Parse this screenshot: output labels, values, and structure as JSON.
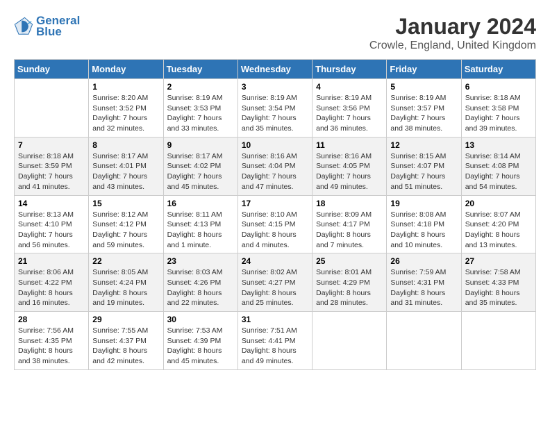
{
  "header": {
    "logo_line1": "General",
    "logo_line2": "Blue",
    "title": "January 2024",
    "subtitle": "Crowle, England, United Kingdom"
  },
  "weekdays": [
    "Sunday",
    "Monday",
    "Tuesday",
    "Wednesday",
    "Thursday",
    "Friday",
    "Saturday"
  ],
  "weeks": [
    [
      {
        "day": "",
        "info": ""
      },
      {
        "day": "1",
        "info": "Sunrise: 8:20 AM\nSunset: 3:52 PM\nDaylight: 7 hours\nand 32 minutes."
      },
      {
        "day": "2",
        "info": "Sunrise: 8:19 AM\nSunset: 3:53 PM\nDaylight: 7 hours\nand 33 minutes."
      },
      {
        "day": "3",
        "info": "Sunrise: 8:19 AM\nSunset: 3:54 PM\nDaylight: 7 hours\nand 35 minutes."
      },
      {
        "day": "4",
        "info": "Sunrise: 8:19 AM\nSunset: 3:56 PM\nDaylight: 7 hours\nand 36 minutes."
      },
      {
        "day": "5",
        "info": "Sunrise: 8:19 AM\nSunset: 3:57 PM\nDaylight: 7 hours\nand 38 minutes."
      },
      {
        "day": "6",
        "info": "Sunrise: 8:18 AM\nSunset: 3:58 PM\nDaylight: 7 hours\nand 39 minutes."
      }
    ],
    [
      {
        "day": "7",
        "info": "Sunrise: 8:18 AM\nSunset: 3:59 PM\nDaylight: 7 hours\nand 41 minutes."
      },
      {
        "day": "8",
        "info": "Sunrise: 8:17 AM\nSunset: 4:01 PM\nDaylight: 7 hours\nand 43 minutes."
      },
      {
        "day": "9",
        "info": "Sunrise: 8:17 AM\nSunset: 4:02 PM\nDaylight: 7 hours\nand 45 minutes."
      },
      {
        "day": "10",
        "info": "Sunrise: 8:16 AM\nSunset: 4:04 PM\nDaylight: 7 hours\nand 47 minutes."
      },
      {
        "day": "11",
        "info": "Sunrise: 8:16 AM\nSunset: 4:05 PM\nDaylight: 7 hours\nand 49 minutes."
      },
      {
        "day": "12",
        "info": "Sunrise: 8:15 AM\nSunset: 4:07 PM\nDaylight: 7 hours\nand 51 minutes."
      },
      {
        "day": "13",
        "info": "Sunrise: 8:14 AM\nSunset: 4:08 PM\nDaylight: 7 hours\nand 54 minutes."
      }
    ],
    [
      {
        "day": "14",
        "info": "Sunrise: 8:13 AM\nSunset: 4:10 PM\nDaylight: 7 hours\nand 56 minutes."
      },
      {
        "day": "15",
        "info": "Sunrise: 8:12 AM\nSunset: 4:12 PM\nDaylight: 7 hours\nand 59 minutes."
      },
      {
        "day": "16",
        "info": "Sunrise: 8:11 AM\nSunset: 4:13 PM\nDaylight: 8 hours\nand 1 minute."
      },
      {
        "day": "17",
        "info": "Sunrise: 8:10 AM\nSunset: 4:15 PM\nDaylight: 8 hours\nand 4 minutes."
      },
      {
        "day": "18",
        "info": "Sunrise: 8:09 AM\nSunset: 4:17 PM\nDaylight: 8 hours\nand 7 minutes."
      },
      {
        "day": "19",
        "info": "Sunrise: 8:08 AM\nSunset: 4:18 PM\nDaylight: 8 hours\nand 10 minutes."
      },
      {
        "day": "20",
        "info": "Sunrise: 8:07 AM\nSunset: 4:20 PM\nDaylight: 8 hours\nand 13 minutes."
      }
    ],
    [
      {
        "day": "21",
        "info": "Sunrise: 8:06 AM\nSunset: 4:22 PM\nDaylight: 8 hours\nand 16 minutes."
      },
      {
        "day": "22",
        "info": "Sunrise: 8:05 AM\nSunset: 4:24 PM\nDaylight: 8 hours\nand 19 minutes."
      },
      {
        "day": "23",
        "info": "Sunrise: 8:03 AM\nSunset: 4:26 PM\nDaylight: 8 hours\nand 22 minutes."
      },
      {
        "day": "24",
        "info": "Sunrise: 8:02 AM\nSunset: 4:27 PM\nDaylight: 8 hours\nand 25 minutes."
      },
      {
        "day": "25",
        "info": "Sunrise: 8:01 AM\nSunset: 4:29 PM\nDaylight: 8 hours\nand 28 minutes."
      },
      {
        "day": "26",
        "info": "Sunrise: 7:59 AM\nSunset: 4:31 PM\nDaylight: 8 hours\nand 31 minutes."
      },
      {
        "day": "27",
        "info": "Sunrise: 7:58 AM\nSunset: 4:33 PM\nDaylight: 8 hours\nand 35 minutes."
      }
    ],
    [
      {
        "day": "28",
        "info": "Sunrise: 7:56 AM\nSunset: 4:35 PM\nDaylight: 8 hours\nand 38 minutes."
      },
      {
        "day": "29",
        "info": "Sunrise: 7:55 AM\nSunset: 4:37 PM\nDaylight: 8 hours\nand 42 minutes."
      },
      {
        "day": "30",
        "info": "Sunrise: 7:53 AM\nSunset: 4:39 PM\nDaylight: 8 hours\nand 45 minutes."
      },
      {
        "day": "31",
        "info": "Sunrise: 7:51 AM\nSunset: 4:41 PM\nDaylight: 8 hours\nand 49 minutes."
      },
      {
        "day": "",
        "info": ""
      },
      {
        "day": "",
        "info": ""
      },
      {
        "day": "",
        "info": ""
      }
    ]
  ]
}
